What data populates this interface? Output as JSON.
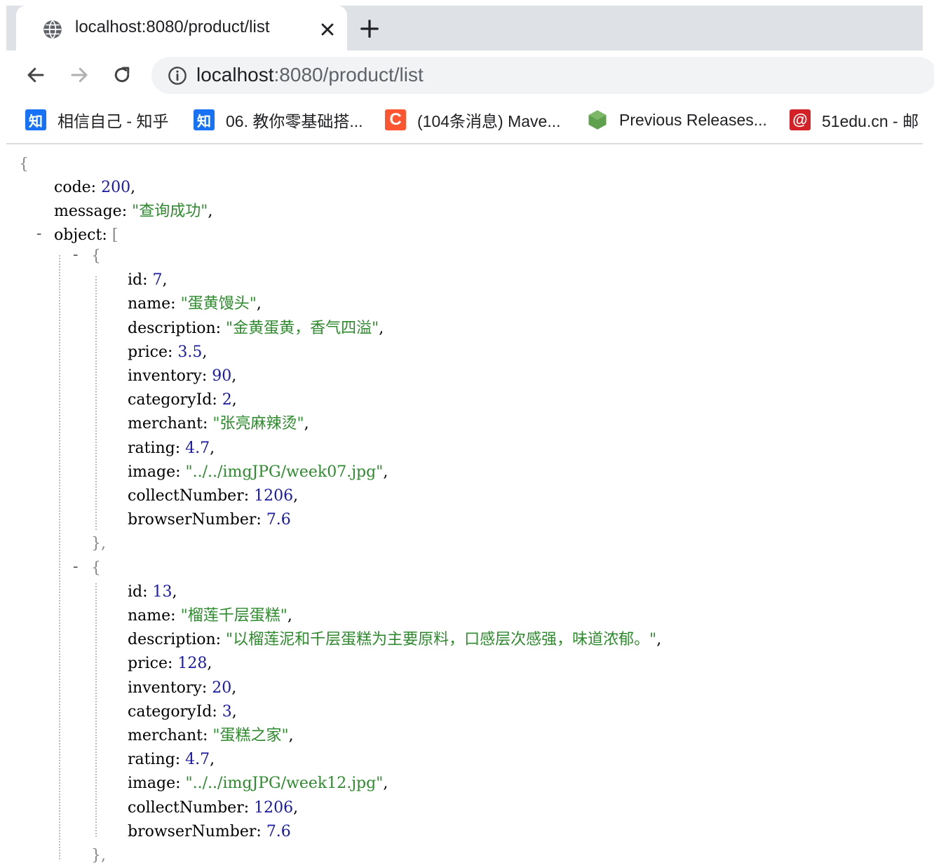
{
  "tab": {
    "title": "localhost:8080/product/list",
    "globe_icon": "globe-icon",
    "close_icon": "close-icon",
    "new_tab_icon": "plus-icon"
  },
  "omnibox": {
    "host": "localhost",
    "rest": ":8080/product/list",
    "info_icon": "info-icon"
  },
  "nav": {
    "back_icon": "arrow-left-icon",
    "forward_icon": "arrow-right-icon",
    "reload_icon": "reload-icon"
  },
  "bookmarks": [
    {
      "label": "相信自己 - 知乎",
      "icon": "zhihu-icon",
      "color": "#1772f6"
    },
    {
      "label": "06. 教你零基础搭...",
      "icon": "zhihu-icon",
      "color": "#1772f6"
    },
    {
      "label": "(104条消息) Mave...",
      "icon": "csdn-icon",
      "color": "#fc5531"
    },
    {
      "label": "Previous Releases...",
      "icon": "nodejs-icon",
      "color": "#5fa04e"
    },
    {
      "label": "51edu.cn - 邮",
      "icon": "mail-at-icon",
      "color": "#d42027"
    }
  ],
  "json": {
    "open_brace": "{",
    "code": {
      "key": "code",
      "value": "200"
    },
    "message": {
      "key": "message",
      "value": "\"查询成功\""
    },
    "object": {
      "key": "object",
      "open": "["
    },
    "collapse_symbol": "-",
    "items": [
      {
        "open": "{",
        "close": "},",
        "fields": [
          {
            "key": "id",
            "value": "7",
            "type": "num"
          },
          {
            "key": "name",
            "value": "\"蛋黄馒头\"",
            "type": "str"
          },
          {
            "key": "description",
            "value": "\"金黄蛋黄，香气四溢\"",
            "type": "str"
          },
          {
            "key": "price",
            "value": "3.5",
            "type": "num"
          },
          {
            "key": "inventory",
            "value": "90",
            "type": "num"
          },
          {
            "key": "categoryId",
            "value": "2",
            "type": "num"
          },
          {
            "key": "merchant",
            "value": "\"张亮麻辣烫\"",
            "type": "str"
          },
          {
            "key": "rating",
            "value": "4.7",
            "type": "num"
          },
          {
            "key": "image",
            "value": "\"../../imgJPG/week07.jpg\"",
            "type": "str"
          },
          {
            "key": "collectNumber",
            "value": "1206",
            "type": "num"
          },
          {
            "key": "browserNumber",
            "value": "7.6",
            "type": "num"
          }
        ]
      },
      {
        "open": "{",
        "close": "},",
        "fields": [
          {
            "key": "id",
            "value": "13",
            "type": "num"
          },
          {
            "key": "name",
            "value": "\"榴莲千层蛋糕\"",
            "type": "str"
          },
          {
            "key": "description",
            "value": "\"以榴莲泥和千层蛋糕为主要原料，口感层次感强，味道浓郁。\"",
            "type": "str"
          },
          {
            "key": "price",
            "value": "128",
            "type": "num"
          },
          {
            "key": "inventory",
            "value": "20",
            "type": "num"
          },
          {
            "key": "categoryId",
            "value": "3",
            "type": "num"
          },
          {
            "key": "merchant",
            "value": "\"蛋糕之家\"",
            "type": "str"
          },
          {
            "key": "rating",
            "value": "4.7",
            "type": "num"
          },
          {
            "key": "image",
            "value": "\"../../imgJPG/week12.jpg\"",
            "type": "str"
          },
          {
            "key": "collectNumber",
            "value": "1206",
            "type": "num"
          },
          {
            "key": "browserNumber",
            "value": "7.6",
            "type": "num"
          }
        ]
      }
    ]
  }
}
